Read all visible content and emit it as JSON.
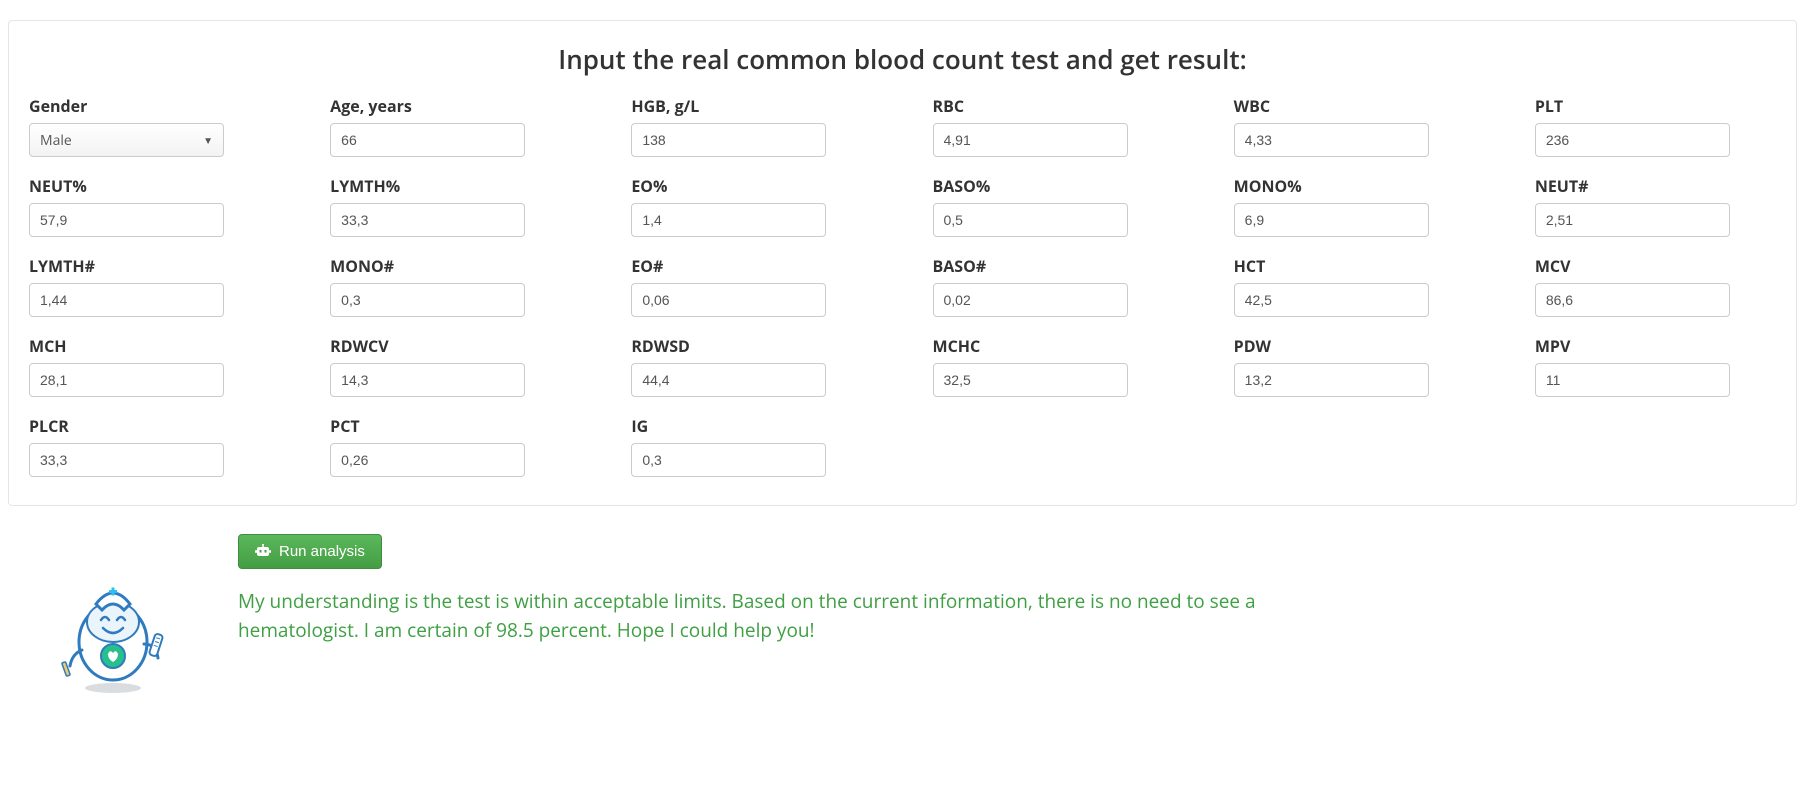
{
  "title": "Input the real common blood count test and get result:",
  "fields": {
    "gender": {
      "label": "Gender",
      "value": "Male",
      "type": "select"
    },
    "age": {
      "label": "Age, years",
      "value": "66"
    },
    "hgb": {
      "label": "HGB, g/L",
      "value": "138"
    },
    "rbc": {
      "label": "RBC",
      "value": "4,91"
    },
    "wbc": {
      "label": "WBC",
      "value": "4,33"
    },
    "plt": {
      "label": "PLT",
      "value": "236"
    },
    "neut_pct": {
      "label": "NEUT%",
      "value": "57,9"
    },
    "lymth_pct": {
      "label": "LYMTH%",
      "value": "33,3"
    },
    "eo_pct": {
      "label": "EO%",
      "value": "1,4"
    },
    "baso_pct": {
      "label": "BASO%",
      "value": "0,5"
    },
    "mono_pct": {
      "label": "MONO%",
      "value": "6,9"
    },
    "neut_abs": {
      "label": "NEUT#",
      "value": "2,51"
    },
    "lymth_abs": {
      "label": "LYMTH#",
      "value": "1,44"
    },
    "mono_abs": {
      "label": "MONO#",
      "value": "0,3"
    },
    "eo_abs": {
      "label": "EO#",
      "value": "0,06"
    },
    "baso_abs": {
      "label": "BASO#",
      "value": "0,02"
    },
    "hct": {
      "label": "HCT",
      "value": "42,5"
    },
    "mcv": {
      "label": "MCV",
      "value": "86,6"
    },
    "mch": {
      "label": "MCH",
      "value": "28,1"
    },
    "rdwcv": {
      "label": "RDWCV",
      "value": "14,3"
    },
    "rdwsd": {
      "label": "RDWSD",
      "value": "44,4"
    },
    "mchc": {
      "label": "MCHC",
      "value": "32,5"
    },
    "pdw": {
      "label": "PDW",
      "value": "13,2"
    },
    "mpv": {
      "label": "MPV",
      "value": "11"
    },
    "plcr": {
      "label": "PLCR",
      "value": "33,3"
    },
    "pct": {
      "label": "PCT",
      "value": "0,26"
    },
    "ig": {
      "label": "IG",
      "value": "0,3"
    }
  },
  "field_order": [
    "gender",
    "age",
    "hgb",
    "rbc",
    "wbc",
    "plt",
    "neut_pct",
    "lymth_pct",
    "eo_pct",
    "baso_pct",
    "mono_pct",
    "neut_abs",
    "lymth_abs",
    "mono_abs",
    "eo_abs",
    "baso_abs",
    "hct",
    "mcv",
    "mch",
    "rdwcv",
    "rdwsd",
    "mchc",
    "pdw",
    "mpv",
    "plcr",
    "pct",
    "ig"
  ],
  "run_button": "Run analysis",
  "result_text": "My understanding is the test is within acceptable limits. Based on the current information, there is no need to see a hematologist. I am certain of 98.5 percent. Hope I could help you!"
}
